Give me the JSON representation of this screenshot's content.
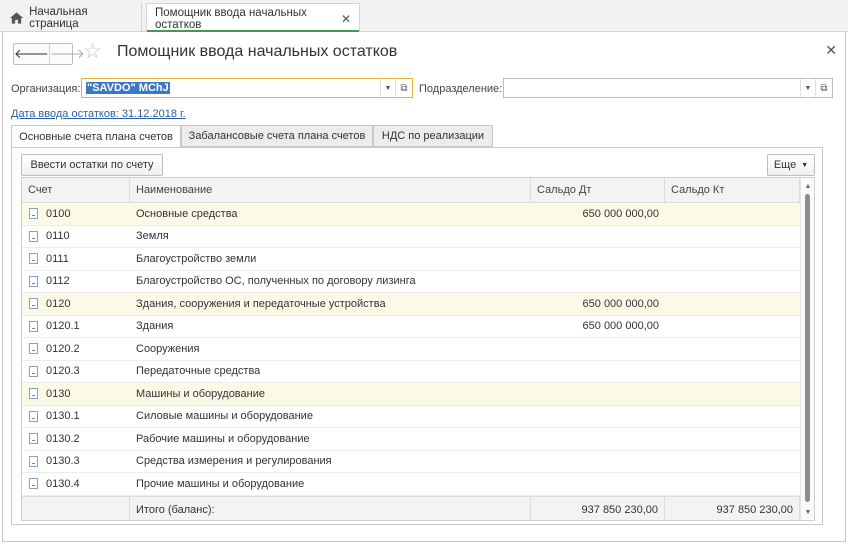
{
  "top_tabs": {
    "home_label": "Начальная страница",
    "active_label": "Помощник ввода начальных остатков"
  },
  "window": {
    "title": "Помощник ввода начальных остатков"
  },
  "form": {
    "org_label": "Организация:",
    "org_value": "\"SAVDO\" MChJ",
    "dept_label": "Подразделение:",
    "dept_value": "",
    "date_link": "Дата ввода остатков: 31.12.2018 г."
  },
  "tabs": [
    {
      "label": "Основные счета плана счетов",
      "active": true
    },
    {
      "label": "Забалансовые счета плана счетов",
      "active": false
    },
    {
      "label": "НДС по реализации",
      "active": false
    }
  ],
  "toolbar": {
    "enter_button": "Ввести остатки по счету",
    "more_button": "Еще"
  },
  "table": {
    "columns": [
      "Счет",
      "Наименование",
      "Сальдо Дт",
      "Сальдо Кт"
    ],
    "rows": [
      {
        "account": "0100",
        "name": "Основные средства",
        "debit": "650 000 000,00",
        "credit": "",
        "highlight": true
      },
      {
        "account": "0110",
        "name": "Земля",
        "debit": "",
        "credit": "",
        "highlight": false
      },
      {
        "account": "0111",
        "name": "Благоустройство земли",
        "debit": "",
        "credit": "",
        "highlight": false
      },
      {
        "account": "0112",
        "name": "Благоустройство ОС, полученных по договору лизинга",
        "debit": "",
        "credit": "",
        "highlight": false
      },
      {
        "account": "0120",
        "name": "Здания, сооружения и передаточные устройства",
        "debit": "650 000 000,00",
        "credit": "",
        "highlight": true
      },
      {
        "account": "0120.1",
        "name": "Здания",
        "debit": "650 000 000,00",
        "credit": "",
        "highlight": false
      },
      {
        "account": "0120.2",
        "name": "Сооружения",
        "debit": "",
        "credit": "",
        "highlight": false
      },
      {
        "account": "0120.3",
        "name": "Передаточные средства",
        "debit": "",
        "credit": "",
        "highlight": false
      },
      {
        "account": "0130",
        "name": "Машины и оборудование",
        "debit": "",
        "credit": "",
        "highlight": true
      },
      {
        "account": "0130.1",
        "name": "Силовые машины и оборудование",
        "debit": "",
        "credit": "",
        "highlight": false
      },
      {
        "account": "0130.2",
        "name": "Рабочие машины и оборудование",
        "debit": "",
        "credit": "",
        "highlight": false
      },
      {
        "account": "0130.3",
        "name": "Средства измерения и регулирования",
        "debit": "",
        "credit": "",
        "highlight": false
      },
      {
        "account": "0130.4",
        "name": "Прочие машины и оборудование",
        "debit": "",
        "credit": "",
        "highlight": false
      }
    ],
    "footer": {
      "label": "Итого (баланс):",
      "debit": "937 850 230,00",
      "credit": "937 850 230,00"
    }
  },
  "colors": {
    "accent_green": "#3c9b57",
    "focus_border": "#e8b53a",
    "selection": "#3a77c9",
    "row_highlight": "#fcfae6",
    "link": "#2a5fa8"
  }
}
